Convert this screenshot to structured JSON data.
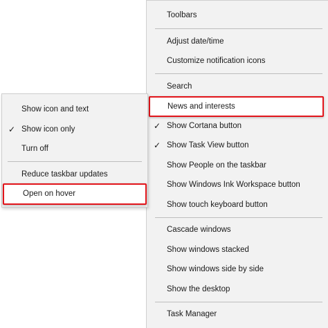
{
  "taskbar_menu": {
    "toolbars": "Toolbars",
    "adjust_date_time": "Adjust date/time",
    "customize_notification_icons": "Customize notification icons",
    "search": "Search",
    "news_and_interests": "News and interests",
    "show_cortana_button": "Show Cortana button",
    "show_task_view_button": "Show Task View button",
    "show_people": "Show People on the taskbar",
    "show_windows_ink": "Show Windows Ink Workspace button",
    "show_touch_keyboard": "Show touch keyboard button",
    "cascade_windows": "Cascade windows",
    "show_windows_stacked": "Show windows stacked",
    "show_windows_side_by_side": "Show windows side by side",
    "show_desktop": "Show the desktop",
    "task_manager": "Task Manager"
  },
  "news_submenu": {
    "show_icon_and_text": "Show icon and text",
    "show_icon_only": "Show icon only",
    "turn_off": "Turn off",
    "reduce_taskbar_updates": "Reduce taskbar updates",
    "open_on_hover": "Open on hover"
  },
  "checkmark": "✓",
  "colors": {
    "menu_background": "#f2f2f2",
    "highlight_border": "#e2141a",
    "separator": "#bdbdbd"
  }
}
